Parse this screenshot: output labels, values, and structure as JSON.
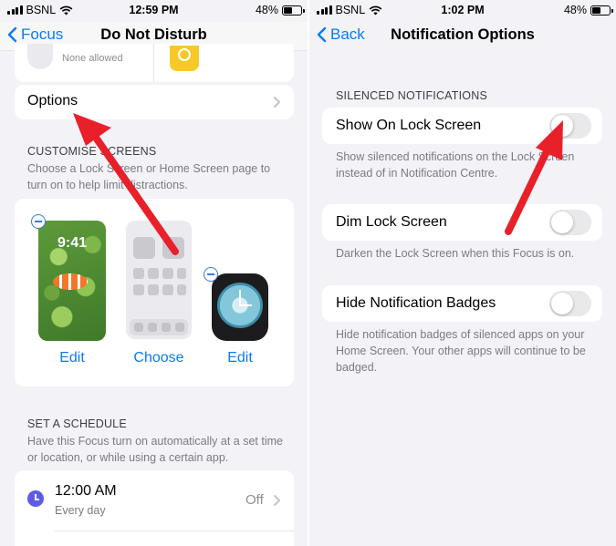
{
  "left": {
    "status": {
      "carrier": "BSNL",
      "time": "12:59 PM",
      "battery": "48%"
    },
    "nav": {
      "back_label": "Focus",
      "title": "Do Not Disturb"
    },
    "top_card": {
      "none_allowed": "None allowed"
    },
    "options_label": "Options",
    "customise": {
      "header": "CUSTOMISE SCREENS",
      "note": "Choose a Lock Screen or Home Screen page to turn on to help limit distractions.",
      "lock_time": "9:41",
      "edit_1": "Edit",
      "choose": "Choose",
      "edit_2": "Edit"
    },
    "schedule": {
      "header": "SET A SCHEDULE",
      "note": "Have this Focus turn on automatically at a set time or location, or while using a certain app.",
      "time": "12:00 AM",
      "repeat": "Every day",
      "state": "Off"
    }
  },
  "right": {
    "status": {
      "carrier": "BSNL",
      "time": "1:02 PM",
      "battery": "48%"
    },
    "nav": {
      "back_label": "Back",
      "title": "Notification Options"
    },
    "section_header": "SILENCED NOTIFICATIONS",
    "rows": [
      {
        "label": "Show On Lock Screen",
        "on": false,
        "note": "Show silenced notifications on the Lock Screen instead of in Notification Centre."
      },
      {
        "label": "Dim Lock Screen",
        "on": false,
        "note": "Darken the Lock Screen when this Focus is on."
      },
      {
        "label": "Hide Notification Badges",
        "on": false,
        "note": "Hide notification badges of silenced apps on your Home Screen. Your other apps will continue to be badged."
      }
    ]
  },
  "colors": {
    "accent": "#0a7cf3",
    "arrow": "#e8202a",
    "background": "#f2f2f7"
  }
}
